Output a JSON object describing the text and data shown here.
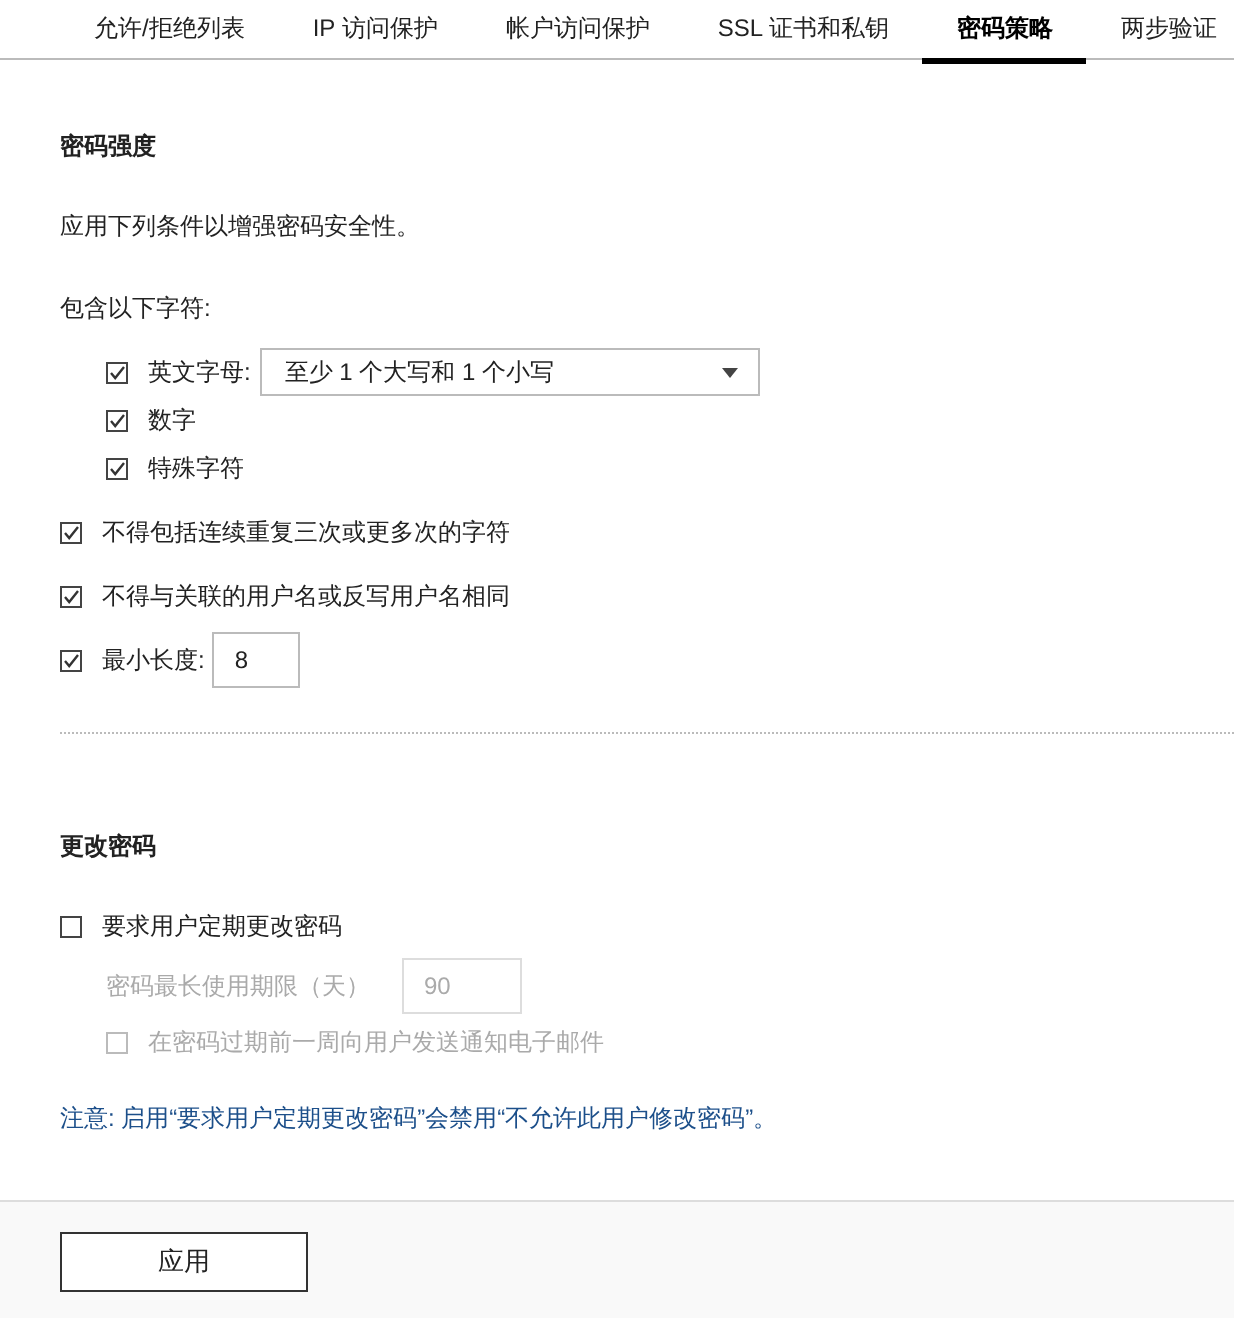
{
  "tabs": [
    {
      "label": "允许/拒绝列表",
      "selected": false
    },
    {
      "label": "IP 访问保护",
      "selected": false
    },
    {
      "label": "帐户访问保护",
      "selected": false
    },
    {
      "label": "SSL 证书和私钥",
      "selected": false
    },
    {
      "label": "密码策略",
      "selected": true
    },
    {
      "label": "两步验证",
      "selected": false
    }
  ],
  "password_strength": {
    "title": "密码强度",
    "description": "应用下列条件以增强密码安全性。",
    "include_label": "包含以下字符:",
    "char_options": [
      {
        "kind": "dropdown",
        "label": "英文字母:",
        "checked": true,
        "value": "至少 1 个大写和 1 个小写"
      },
      {
        "kind": "plain",
        "label": "数字",
        "checked": true
      },
      {
        "kind": "plain",
        "label": "特殊字符",
        "checked": true
      }
    ],
    "rules": [
      {
        "kind": "plain",
        "label": "不得包括连续重复三次或更多次的字符",
        "checked": true
      },
      {
        "kind": "plain",
        "label": "不得与关联的用户名或反写用户名相同",
        "checked": true
      },
      {
        "kind": "number",
        "label": "最小长度:",
        "checked": true,
        "value": "8"
      }
    ]
  },
  "change_password": {
    "title": "更改密码",
    "require": {
      "label": "要求用户定期更改密码",
      "checked": false
    },
    "max_age": {
      "label": "密码最长使用期限（天）",
      "value": "90",
      "disabled": true
    },
    "notify": {
      "label": "在密码过期前一周向用户发送通知电子邮件",
      "checked": false,
      "disabled": true
    },
    "note": "注意: 启用“要求用户定期更改密码”会禁用“不允许此用户修改密码”。"
  },
  "apply_button": "应用"
}
